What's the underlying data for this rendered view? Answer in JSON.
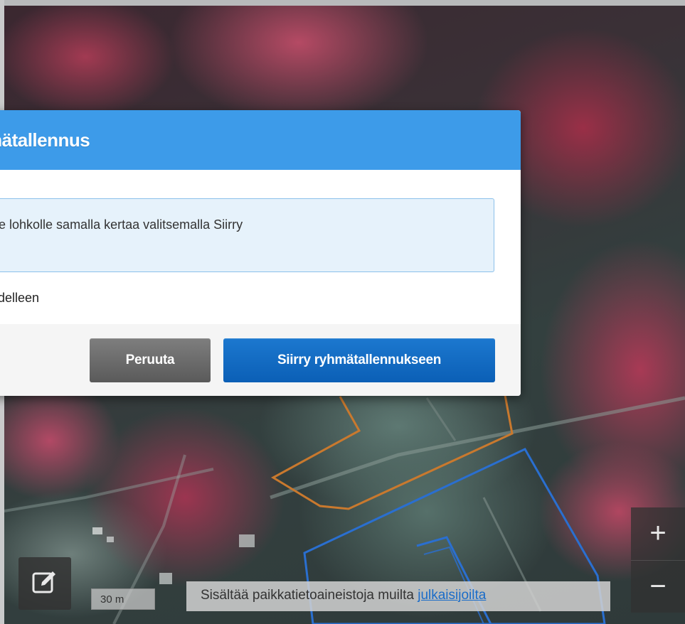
{
  "dialog": {
    "title": "mätallennus",
    "info_text": "e lohkolle samalla kertaa valitsemalla Siirry",
    "body_text": "delleen",
    "cancel_label": "Peruuta",
    "primary_label": "Siirry ryhmätallennukseen"
  },
  "map": {
    "scale_label": "30 m",
    "attribution_text": "Sisältää paikkatietoaineistoja muilta ",
    "attribution_link": "julkaisijoilta",
    "zoom_in_label": "+",
    "zoom_out_label": "−"
  },
  "colors": {
    "header_blue": "#3d9be9",
    "primary_button": "#1c78cf",
    "cancel_button": "#6b6b6b",
    "parcel_orange": "#c9792e",
    "parcel_blue": "#2a6fd0"
  },
  "icons": {
    "edit": "edit-icon"
  }
}
